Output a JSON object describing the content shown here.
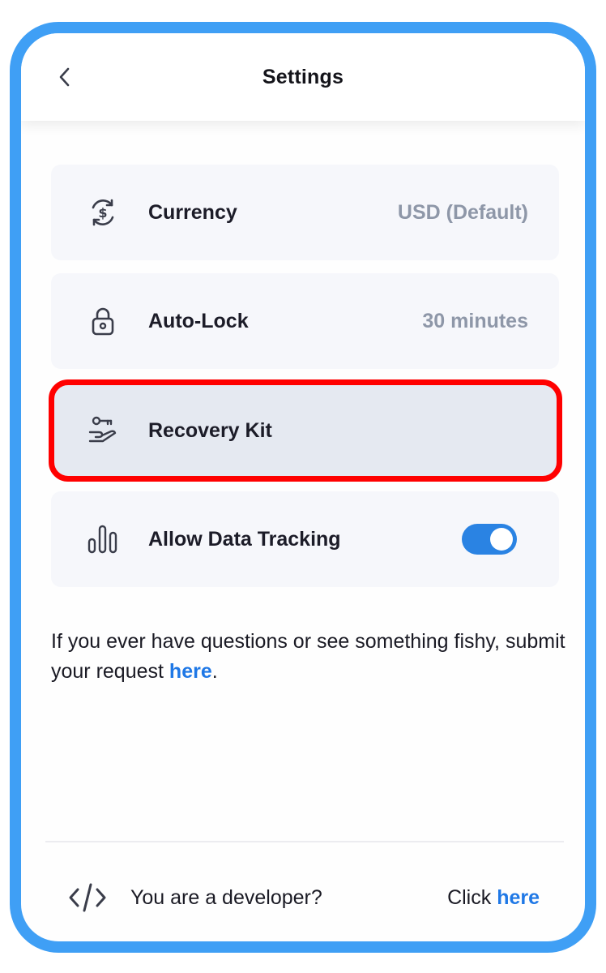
{
  "header": {
    "title": "Settings",
    "back_icon": "chevron-left-icon"
  },
  "settings": {
    "currency": {
      "label": "Currency",
      "value": "USD (Default)",
      "icon": "currency-exchange-icon"
    },
    "auto_lock": {
      "label": "Auto-Lock",
      "value": "30 minutes",
      "icon": "lock-icon"
    },
    "recovery_kit": {
      "label": "Recovery Kit",
      "icon": "key-in-hand-icon",
      "highlighted": true
    },
    "data_tracking": {
      "label": "Allow Data Tracking",
      "icon": "bar-chart-icon",
      "enabled": true
    }
  },
  "help": {
    "text_before": "If you ever have questions or see something fishy, submit your request ",
    "link": "here",
    "text_after": "."
  },
  "footer": {
    "icon": "code-icon",
    "text": "You are a developer?",
    "click_label": "Click ",
    "link": "here"
  },
  "colors": {
    "frame": "#3f9ff5",
    "accent": "#1f78e6",
    "toggle_on": "#2a83e3",
    "highlight": "#ff0000",
    "row_bg": "#f6f7fb",
    "muted_value": "#8e97a8"
  }
}
